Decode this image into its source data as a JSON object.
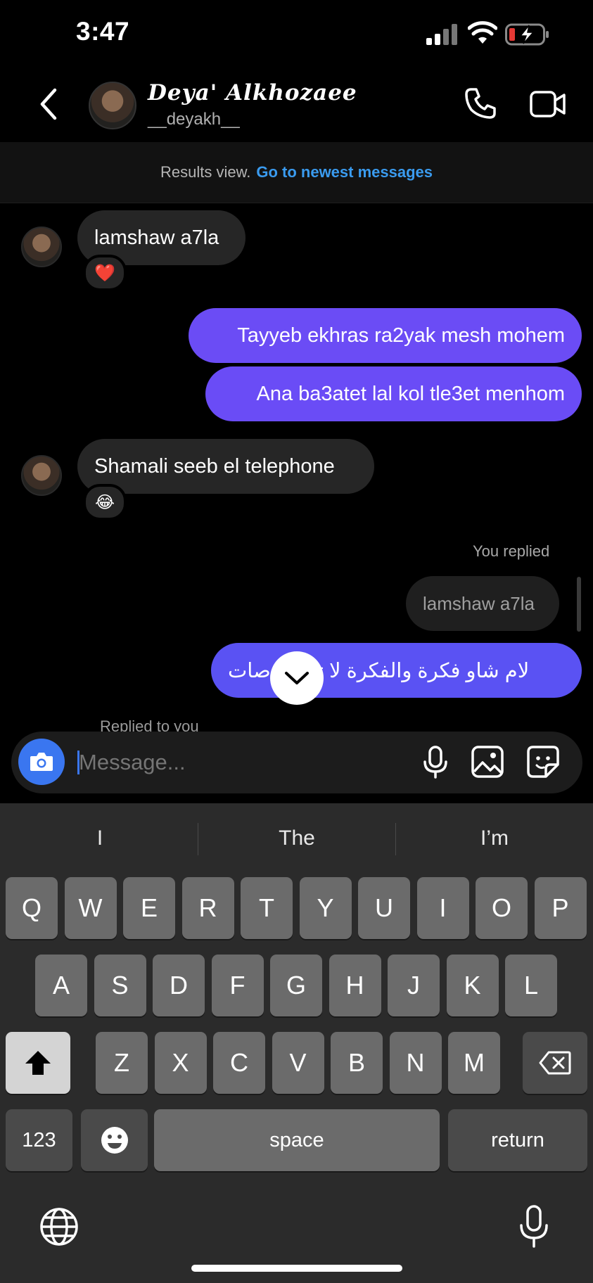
{
  "status_bar": {
    "time": "3:47"
  },
  "header": {
    "name": "Deya' Alkhozaee",
    "handle": "__deyakh__"
  },
  "results_bar": {
    "prefix": "Results view.",
    "link": "Go to newest messages"
  },
  "messages": {
    "m1": {
      "text": "lamshaw a7la",
      "reaction": "❤️"
    },
    "m2": {
      "text": "Tayyeb ekhras ra2yak mesh mohem"
    },
    "m3": {
      "text": "Ana ba3atet lal kol tle3et menhom"
    },
    "m4": {
      "text": "Shamali seeb el telephone",
      "reaction": "😂"
    },
    "reply_label": "You replied",
    "reply_quote": "lamshaw a7la",
    "m5": {
      "text": "لام شاو فكرة والفكرة لا تموت صات"
    },
    "replied_to_you": "Replied to you"
  },
  "composer": {
    "placeholder": "Message..."
  },
  "keyboard": {
    "suggestions": [
      "I",
      "The",
      "I’m"
    ],
    "row1": [
      "Q",
      "W",
      "E",
      "R",
      "T",
      "Y",
      "U",
      "I",
      "O",
      "P"
    ],
    "row2": [
      "A",
      "S",
      "D",
      "F",
      "G",
      "H",
      "J",
      "K",
      "L"
    ],
    "row3": [
      "Z",
      "X",
      "C",
      "V",
      "B",
      "N",
      "M"
    ],
    "numbers_label": "123",
    "space_label": "space",
    "return_label": "return"
  },
  "colors": {
    "accent_link": "#3a9bef",
    "outgoing_bubble": "#6b4cf5",
    "camera_button": "#3a76f0"
  }
}
